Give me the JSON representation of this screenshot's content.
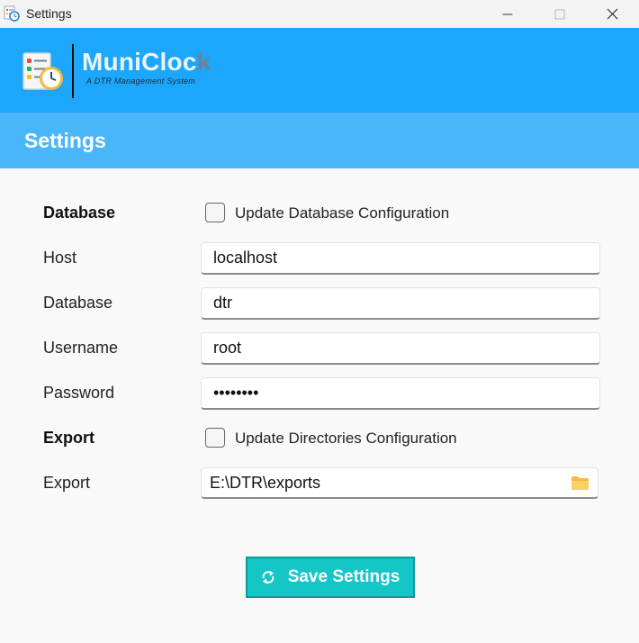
{
  "window": {
    "title": "Settings"
  },
  "brand": {
    "name_main": "MuniCloc",
    "name_tail": "k",
    "tagline": "A DTR Management System"
  },
  "section": {
    "heading": "Settings"
  },
  "database": {
    "section_label": "Database",
    "checkbox_label": "Update Database Configuration",
    "checked": false,
    "host_label": "Host",
    "host_value": "localhost",
    "database_label": "Database",
    "database_value": "dtr",
    "username_label": "Username",
    "username_value": "root",
    "password_label": "Password",
    "password_value": "password"
  },
  "export": {
    "section_label": "Export",
    "checkbox_label": "Update Directories Configuration",
    "checked": false,
    "path_label": "Export",
    "path_value": "E:\\DTR\\exports"
  },
  "actions": {
    "save_label": "Save Settings"
  },
  "colors": {
    "brand_bar": "#1ca7fc",
    "section_bar": "#4ab6fa",
    "save_button": "#14c6c6"
  },
  "icons": {
    "app": "calendar-clock-icon",
    "folder": "folder-icon",
    "save": "sync-icon"
  }
}
